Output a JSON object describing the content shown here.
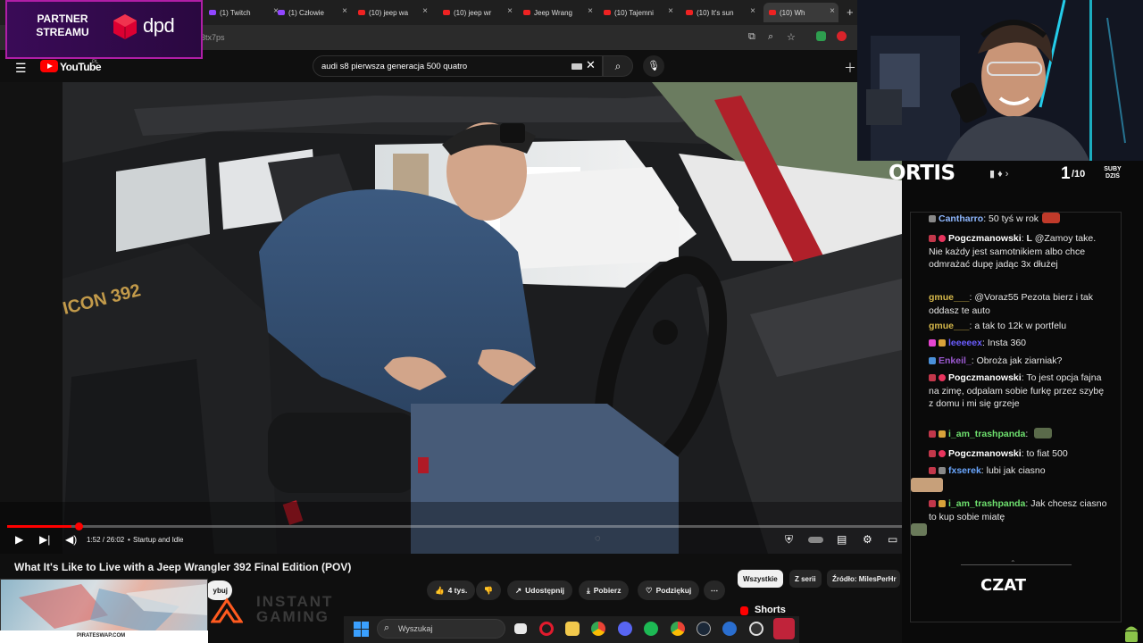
{
  "browser": {
    "tabs": [
      {
        "label": "(1) Twitch",
        "icon": "twitch-icon"
      },
      {
        "label": "(1) Człowie",
        "icon": "twitch-icon"
      },
      {
        "label": "(10) jeep wa",
        "icon": "youtube-icon"
      },
      {
        "label": "(10) jeep wr",
        "icon": "youtube-icon"
      },
      {
        "label": "Jeep Wrang",
        "icon": "youtube-icon"
      },
      {
        "label": "(10) Tajemni",
        "icon": "youtube-icon"
      },
      {
        "label": "(10) It's sun",
        "icon": "youtube-icon"
      },
      {
        "label": "(10) Wh",
        "icon": "youtube-icon",
        "active": true
      }
    ],
    "new_tab": "+",
    "url_fragment": "3tx7ps"
  },
  "youtube": {
    "logo_text": "YouTube",
    "region": "PL",
    "search_query": "audi s8 pierwsza generacja 500 quatro",
    "player": {
      "time": "1:52 / 26:02",
      "chapter": "Startup and Idle",
      "progress": 0.072
    },
    "video_title": "What It's Like to Live with a Jeep Wrangler 392 Final Edition (POV)",
    "subscribe_partial": "ybuj",
    "actions": {
      "likes": "4 tys.",
      "share": "Udostępnij",
      "download": "Pobierz",
      "thanks": "Podziękuj",
      "more": "⋯"
    },
    "chips": [
      "Wszystkie",
      "Z serii",
      "Źródło: MilesPerHr"
    ],
    "shorts": "Shorts",
    "seat_badge": "ICON 392"
  },
  "overlay": {
    "partner_text": "PARTNER STREAMU",
    "sponsor": "dpd",
    "instant_gaming": "INSTANT GAMING",
    "ad_caption": "PIRATESWAP.COM"
  },
  "stream": {
    "streamer": "ORTIS",
    "subs_current": "1",
    "subs_goal": "/10",
    "subs_label": "SUBY DZIŚ",
    "chat_label": "CZAT",
    "chat": [
      {
        "badges": [
          "grey"
        ],
        "user": "Cantharro",
        "user_color": "#8fb8ff",
        "text": "50 tyś w rok",
        "emote": "#c03a2a"
      },
      {
        "badges": [
          "red",
          "heart"
        ],
        "user": "Pogczmanowski",
        "user_color": "#ffffff",
        "text": "@Zamoy take. Nie każdy jest samotnikiem albo chce odmrażać dupę jadąc 3x dłużej",
        "pre": "L "
      },
      {
        "badges": [],
        "user": "gmue___",
        "user_color": "#d6b84a",
        "text": "@Voraz55 Pezota bierz i tak oddasz te auto"
      },
      {
        "badges": [],
        "user": "gmue___",
        "user_color": "#d6b84a",
        "text": "a tak to 12k w portfelu"
      },
      {
        "badges": [
          "pink",
          "gold"
        ],
        "user": "leeeeex",
        "user_color": "#6a5cff",
        "text": "Insta 360"
      },
      {
        "badges": [
          "blue"
        ],
        "user": "Enkeil_",
        "user_color": "#9b59d0",
        "text": "Obroża jak ziarniak?"
      },
      {
        "badges": [
          "red",
          "heart"
        ],
        "user": "Pogczmanowski",
        "user_color": "#ffffff",
        "text": "To jest opcja fajna na zimę, odpalam sobie furkę przez szybę z domu i mi się grzeje"
      },
      {
        "badges": [
          "red",
          "gold"
        ],
        "user": "i_am_trashpanda",
        "user_color": "#6ee06e",
        "text": "",
        "emote": "#5a6a4a"
      },
      {
        "badges": [
          "red",
          "heart"
        ],
        "user": "Pogczmanowski",
        "user_color": "#ffffff",
        "text": "to fiat 500"
      },
      {
        "badges": [
          "red",
          "grey"
        ],
        "user": "fxserek",
        "user_color": "#6aa7ff",
        "text": "lubi jak ciasno",
        "emote_below": "#c7a07a"
      },
      {
        "badges": [
          "red",
          "gold"
        ],
        "user": "i_am_trashpanda",
        "user_color": "#6ee06e",
        "text": "Jak chcesz ciasno to kup sobie miatę",
        "emote_below": "#6a7a5a"
      }
    ]
  },
  "taskbar": {
    "search_placeholder": "Wyszukaj",
    "apps": [
      "opera-icon",
      "files-icon",
      "chrome-icon",
      "discord-icon",
      "spotify-icon",
      "chrome-alt-icon",
      "steam-icon",
      "ccleaner-icon",
      "obs-icon",
      "pin-icon"
    ]
  },
  "colors": {
    "yt_red": "#ff0000",
    "partner_purple": "#3a0b57",
    "dpd_red": "#dc0032"
  }
}
